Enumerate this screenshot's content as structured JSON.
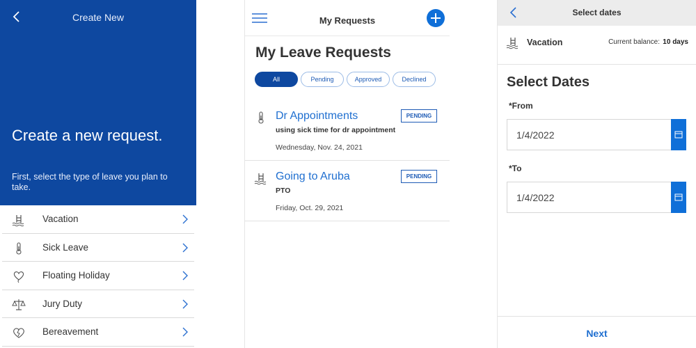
{
  "screen1": {
    "title": "Create New",
    "heading": "Create a new request.",
    "subtitle": "First, select the type of leave you plan to take.",
    "leave_types": [
      {
        "label": "Vacation",
        "icon": "pool-ladder-icon"
      },
      {
        "label": "Sick Leave",
        "icon": "thermometer-icon"
      },
      {
        "label": "Floating Holiday",
        "icon": "balloon-heart-icon"
      },
      {
        "label": "Jury Duty",
        "icon": "scales-icon"
      },
      {
        "label": "Bereavement",
        "icon": "broken-heart-icon"
      }
    ],
    "colors": {
      "hero": "#0e48a0"
    }
  },
  "screen2": {
    "title": "My Requests",
    "heading": "My Leave Requests",
    "filters": [
      "All",
      "Pending",
      "Approved",
      "Declined"
    ],
    "requests": [
      {
        "name": "Dr Appointments",
        "status": "PENDING",
        "description": "using sick time for dr appointment",
        "date": "Wednesday, Nov. 24, 2021",
        "icon": "thermometer-icon"
      },
      {
        "name": "Going to Aruba",
        "status": "PENDING",
        "description": "PTO",
        "date": "Friday, Oct. 29, 2021",
        "icon": "pool-ladder-icon"
      }
    ],
    "colors": {
      "accent": "#0f6fd8",
      "active_filter": "#0e48a0"
    }
  },
  "screen3": {
    "title": "Select dates",
    "leave_type": "Vacation",
    "balance_label": "Current balance:",
    "balance_value": "10 days",
    "heading": "Select Dates",
    "from_label": "*From",
    "from_value": "1/4/2022",
    "to_label": "*To",
    "to_value": "1/4/2022",
    "next_label": "Next",
    "colors": {
      "accent": "#0f6fd8"
    }
  }
}
